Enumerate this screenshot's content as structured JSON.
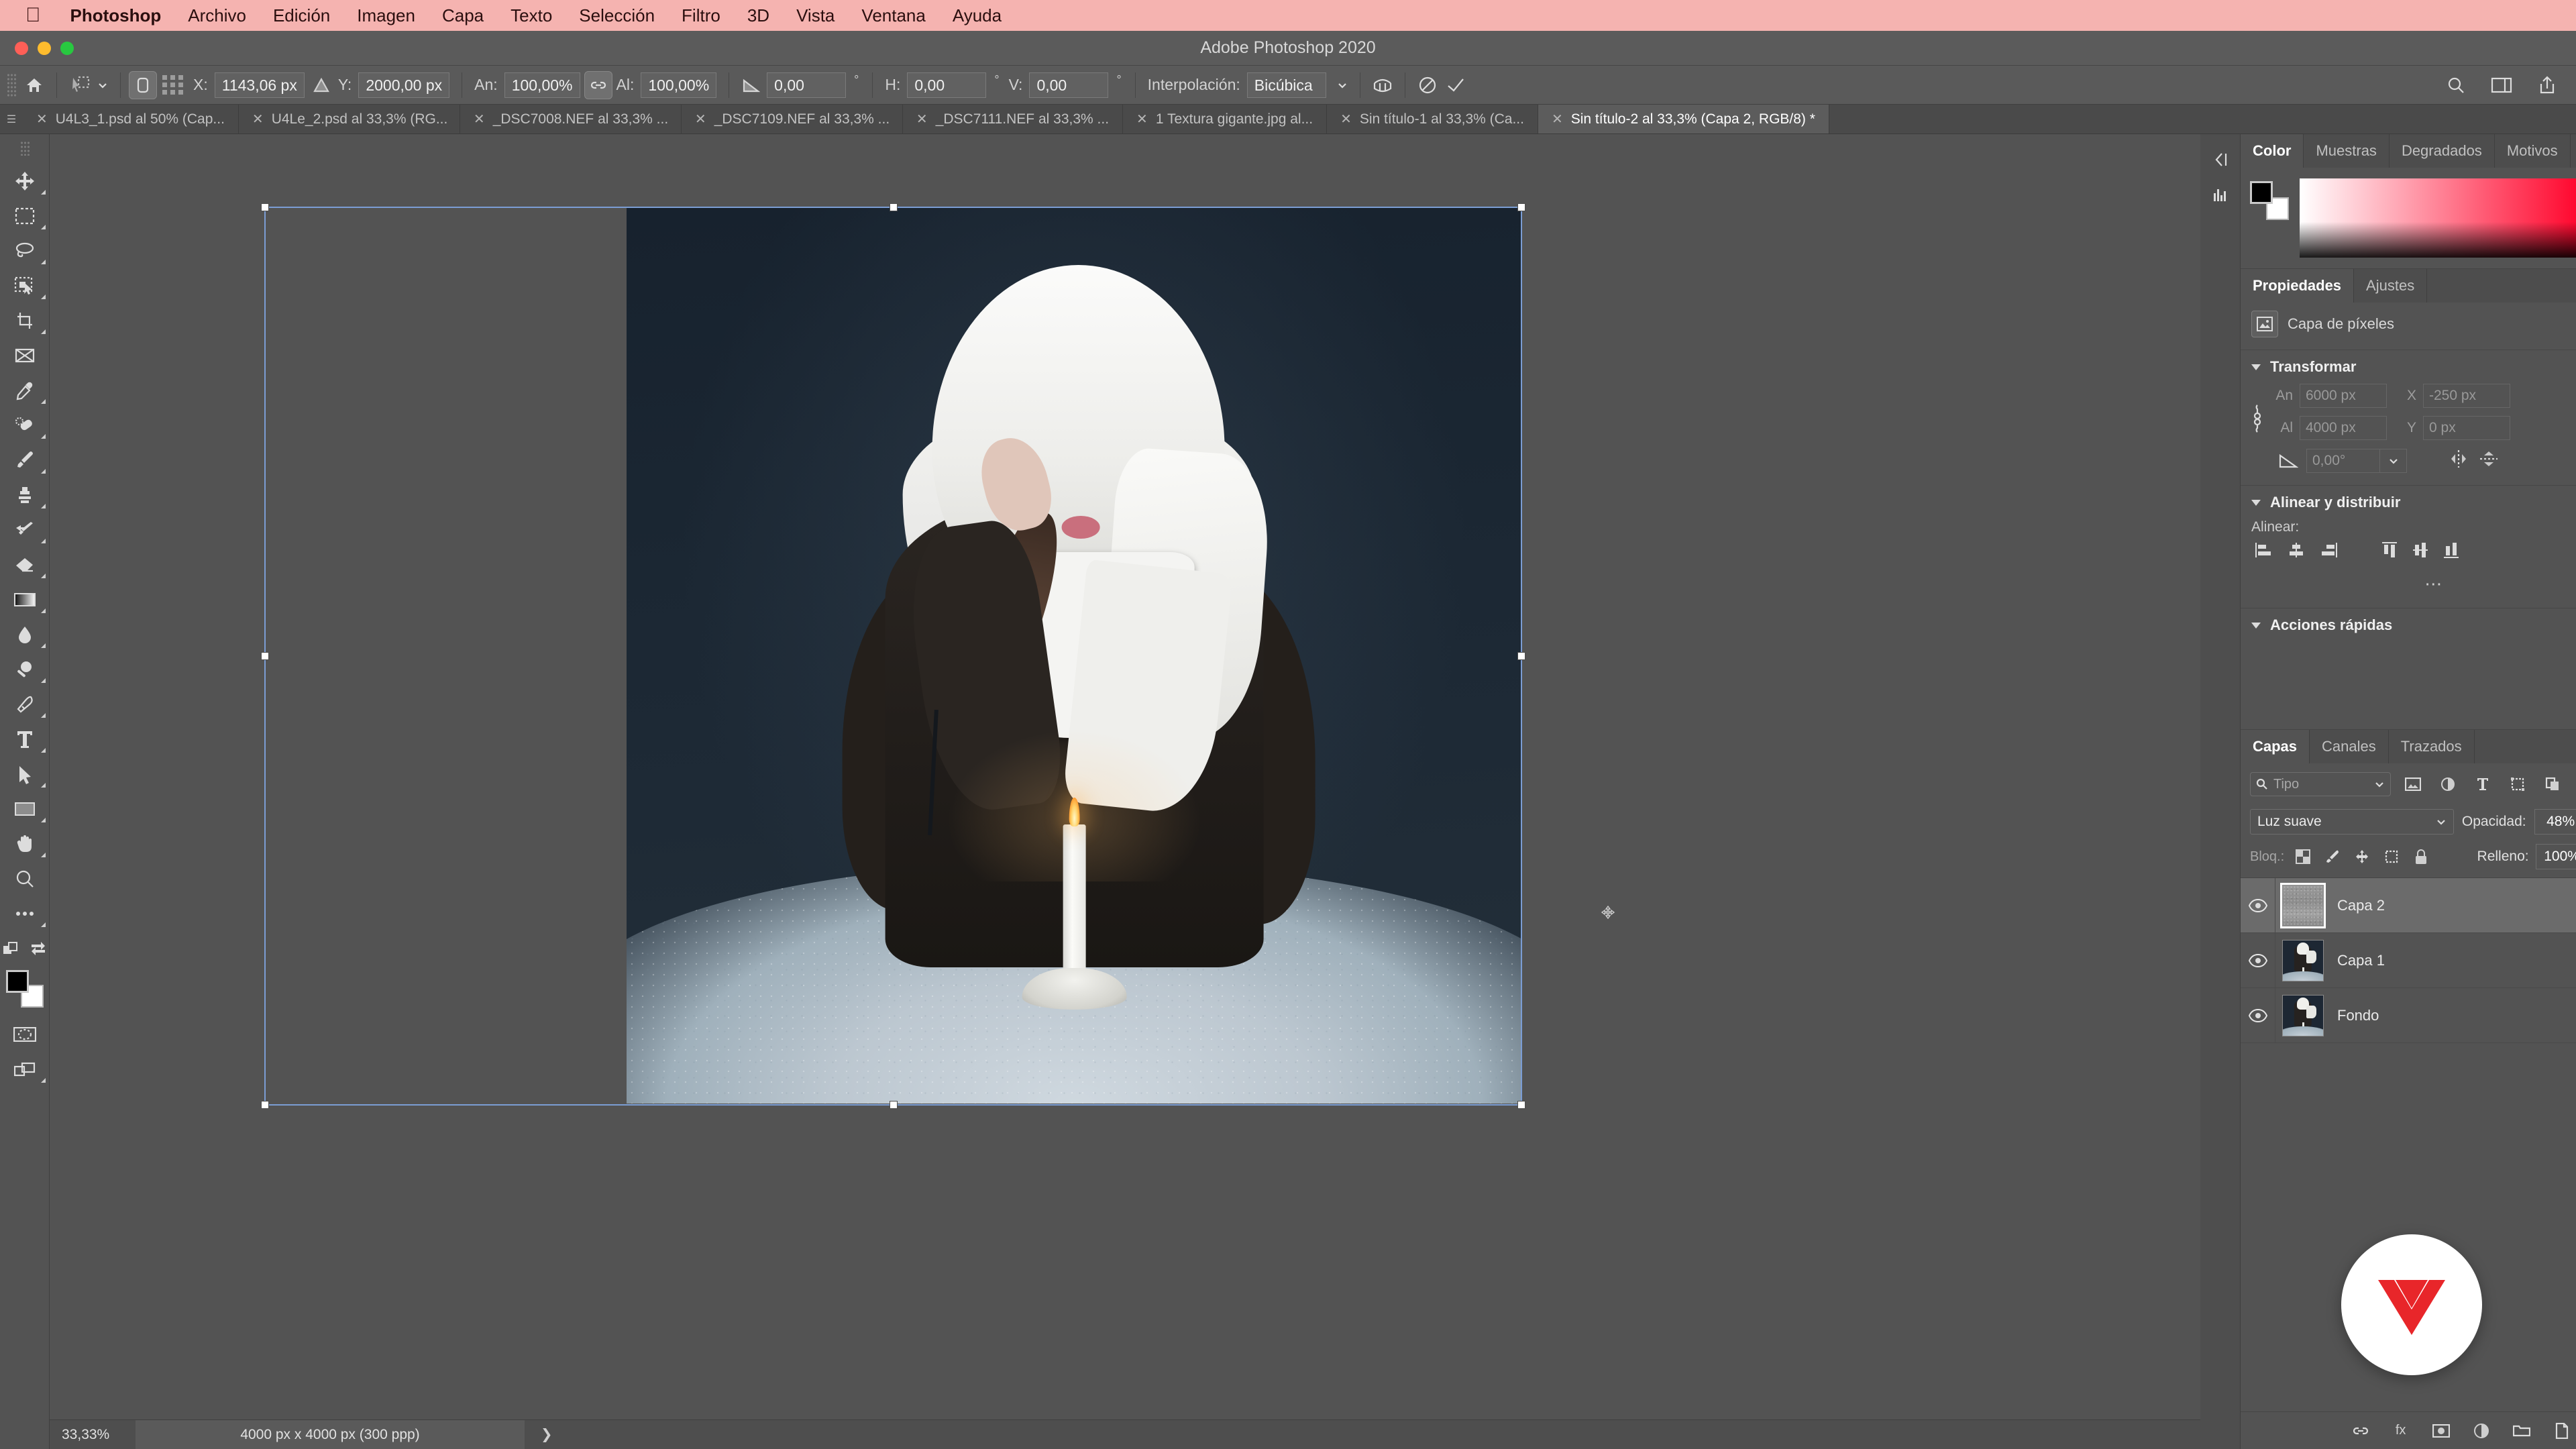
{
  "menubar": {
    "apple_icon": "apple-icon",
    "items": [
      {
        "label": "Photoshop",
        "bold": true
      },
      {
        "label": "Archivo"
      },
      {
        "label": "Edición"
      },
      {
        "label": "Imagen"
      },
      {
        "label": "Capa"
      },
      {
        "label": "Texto"
      },
      {
        "label": "Selección"
      },
      {
        "label": "Filtro"
      },
      {
        "label": "3D"
      },
      {
        "label": "Vista"
      },
      {
        "label": "Ventana"
      },
      {
        "label": "Ayuda"
      }
    ]
  },
  "window": {
    "title": "Adobe Photoshop 2020"
  },
  "options_bar": {
    "home_icon": "home-icon",
    "tool_preset_icon": "move-tool-preset-icon",
    "reference_point_icon": "reference-point-icon",
    "x_label": "X:",
    "x_value": "1143,06 px",
    "delta_icon": "delta-icon",
    "y_label": "Y:",
    "y_value": "2000,00 px",
    "width_label": "An:",
    "width_value": "100,00%",
    "link_icon": "link-icon",
    "height_label": "Al:",
    "height_value": "100,00%",
    "angle_icon": "angle-icon",
    "angle_value": "0,00",
    "degree_symbol": "°",
    "skew_h_label": "H:",
    "skew_h_value": "0,00",
    "skew_v_label": "V:",
    "skew_v_value": "0,00",
    "interpolation_label": "Interpolación:",
    "interpolation_value": "Bicúbica",
    "warp_icon": "warp-icon",
    "cancel_icon": "cancel-transform-icon",
    "commit_icon": "commit-transform-icon",
    "search_icon": "search-icon",
    "arrange_icon": "arrange-documents-icon",
    "share_icon": "share-icon"
  },
  "tabs": [
    {
      "label": "U4L3_1.psd al 50% (Cap...",
      "active": false
    },
    {
      "label": "U4Le_2.psd al 33,3% (RG...",
      "active": false
    },
    {
      "label": "_DSC7008.NEF al 33,3% ...",
      "active": false
    },
    {
      "label": "_DSC7109.NEF al 33,3% ...",
      "active": false
    },
    {
      "label": "_DSC7111.NEF al 33,3% ...",
      "active": false
    },
    {
      "label": "1 Textura gigante.jpg al...",
      "active": false
    },
    {
      "label": "Sin título-1 al 33,3% (Ca...",
      "active": false
    },
    {
      "label": "Sin título-2 al 33,3% (Capa 2, RGB/8) *",
      "active": true
    }
  ],
  "tools": [
    {
      "name": "move-tool",
      "selected": false
    },
    {
      "name": "rectangular-marquee-tool",
      "selected": false
    },
    {
      "name": "lasso-tool",
      "selected": false
    },
    {
      "name": "object-selection-tool",
      "selected": false
    },
    {
      "name": "crop-tool",
      "selected": false
    },
    {
      "name": "frame-tool",
      "selected": false
    },
    {
      "name": "eyedropper-tool",
      "selected": false
    },
    {
      "name": "healing-brush-tool",
      "selected": false
    },
    {
      "name": "brush-tool",
      "selected": false
    },
    {
      "name": "clone-stamp-tool",
      "selected": false
    },
    {
      "name": "history-brush-tool",
      "selected": false
    },
    {
      "name": "eraser-tool",
      "selected": false
    },
    {
      "name": "gradient-tool",
      "selected": false
    },
    {
      "name": "blur-tool",
      "selected": false
    },
    {
      "name": "dodge-tool",
      "selected": false
    },
    {
      "name": "pen-tool",
      "selected": false
    },
    {
      "name": "horizontal-type-tool",
      "selected": false
    },
    {
      "name": "path-selection-tool",
      "selected": false
    },
    {
      "name": "rectangle-tool",
      "selected": false
    },
    {
      "name": "hand-tool",
      "selected": false
    },
    {
      "name": "zoom-tool",
      "selected": false
    },
    {
      "name": "edit-toolbar-tool",
      "selected": false
    }
  ],
  "canvas": {
    "cursor_icon": "move-cursor",
    "bounding_box_color": "#7b9dd4"
  },
  "status_bar": {
    "zoom": "33,33%",
    "doc_info": "4000 px x 4000 px (300 ppp)",
    "arrow_icon": "chevron-right-icon"
  },
  "dock_rail": {
    "icons": [
      "panel-collapse-icon",
      "histogram-icon"
    ]
  },
  "color_panel": {
    "tabs": [
      {
        "label": "Color",
        "active": true
      },
      {
        "label": "Muestras",
        "active": false
      },
      {
        "label": "Degradados",
        "active": false
      },
      {
        "label": "Motivos",
        "active": false
      }
    ],
    "menu_icon": "panel-menu-icon",
    "foreground_color": "#000000",
    "background_color": "#ffffff",
    "ramp_icon": "color-ramp"
  },
  "properties_panel": {
    "tabs": [
      {
        "label": "Propiedades",
        "active": true
      },
      {
        "label": "Ajustes",
        "active": false
      }
    ],
    "menu_icon": "panel-menu-icon",
    "layer_kind_icon": "pixel-layer-icon",
    "layer_kind": "Capa de píxeles",
    "transform": {
      "title": "Transformar",
      "link_icon": "link-aspect-icon",
      "width_label": "An",
      "width_value": "6000 px",
      "x_label": "X",
      "x_value": "-250 px",
      "height_label": "Al",
      "height_value": "4000 px",
      "y_label": "Y",
      "y_value": "0 px",
      "angle_icon": "angle-icon",
      "angle_value": "0,00°",
      "flip_h_icon": "flip-horizontal-icon",
      "flip_v_icon": "flip-vertical-icon"
    },
    "align": {
      "title": "Alinear y distribuir",
      "label": "Alinear:",
      "buttons": [
        "align-left-icon",
        "align-center-horizontal-icon",
        "align-right-icon",
        "align-top-icon",
        "align-middle-vertical-icon",
        "align-bottom-icon"
      ],
      "more_icon": "more-options-icon"
    },
    "quick_actions": {
      "title": "Acciones rápidas"
    }
  },
  "layers_panel": {
    "tabs": [
      {
        "label": "Capas",
        "active": true
      },
      {
        "label": "Canales",
        "active": false
      },
      {
        "label": "Trazados",
        "active": false
      }
    ],
    "menu_icon": "panel-menu-icon",
    "filter": {
      "search_icon": "search-icon",
      "placeholder": "Tipo",
      "chevron_icon": "chevron-down-icon",
      "icons": [
        "filter-pixel-icon",
        "filter-adjustment-icon",
        "filter-type-icon",
        "filter-shape-icon",
        "filter-smart-object-icon"
      ],
      "toggle_icon": "filter-toggle"
    },
    "blend_mode": "Luz suave",
    "blend_chevron_icon": "chevron-down-icon",
    "opacity_label": "Opacidad:",
    "opacity_value": "48%",
    "opacity_chevron_icon": "chevron-down-icon",
    "lock_label": "Bloq.:",
    "lock_icons": [
      "lock-transparency-icon",
      "lock-image-icon",
      "lock-position-icon",
      "lock-artboard-icon",
      "lock-all-icon"
    ],
    "fill_label": "Relleno:",
    "fill_value": "100%",
    "fill_chevron_icon": "chevron-down-icon",
    "layers": [
      {
        "name": "Capa 2",
        "visible": true,
        "selected": true,
        "locked": false,
        "thumb": "noise"
      },
      {
        "name": "Capa 1",
        "visible": true,
        "selected": false,
        "locked": false,
        "thumb": "photo"
      },
      {
        "name": "Fondo",
        "visible": true,
        "selected": false,
        "locked": true,
        "thumb": "photo"
      }
    ],
    "eye_icon": "eye-icon",
    "lock_badge_icon": "lock-icon",
    "footer_icons": [
      "link-layers-icon",
      "layer-style-icon",
      "layer-mask-icon",
      "adjustment-layer-icon",
      "new-group-icon",
      "new-layer-icon",
      "delete-layer-icon"
    ]
  },
  "watermark": {
    "icon": "brand-chevron-logo",
    "color": "#e8262a"
  }
}
